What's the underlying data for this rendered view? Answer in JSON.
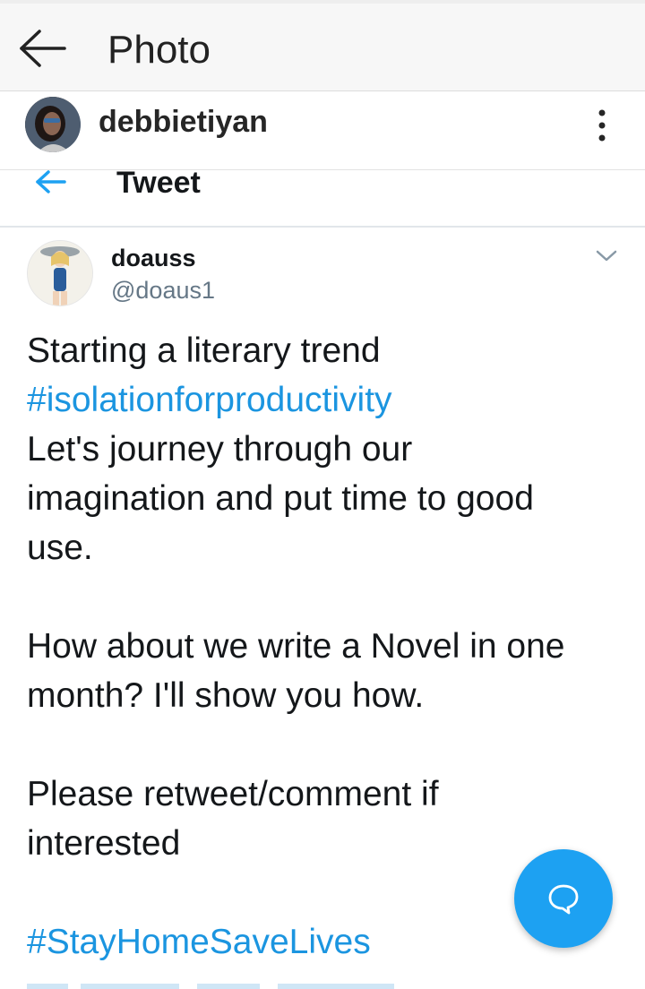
{
  "topbar": {
    "title": "Photo",
    "back_icon": "arrow-left-icon"
  },
  "post": {
    "username": "debbietiyan",
    "more_icon": "more-vertical-icon"
  },
  "tweet_screen": {
    "nav_title": "Tweet",
    "back_icon": "arrow-left-icon",
    "author": {
      "name": "doauss",
      "handle": "@doaus1"
    },
    "menu_icon": "chevron-down-icon",
    "lines": [
      {
        "text": "Starting a literary trend",
        "type": "text"
      },
      {
        "text": "#isolationforproductivity",
        "type": "hashtag"
      },
      {
        "text": "Let's journey through our",
        "type": "text"
      },
      {
        "text": "imagination and put time to good",
        "type": "text"
      },
      {
        "text": "use.",
        "type": "text"
      },
      {
        "text": "",
        "type": "blank"
      },
      {
        "text": "How about we write a Novel in one",
        "type": "text"
      },
      {
        "text": "month? I'll show you how.",
        "type": "text"
      },
      {
        "text": "",
        "type": "blank"
      },
      {
        "text": "Please retweet/comment if",
        "type": "text"
      },
      {
        "text": "interested",
        "type": "text"
      },
      {
        "text": "",
        "type": "blank"
      },
      {
        "text": "#StayHomeSaveLives",
        "type": "hashtag"
      }
    ],
    "fab_icon": "reply-bubble-icon"
  },
  "colors": {
    "accent": "#1da1f2",
    "hashtag": "#1b95e0",
    "handle": "#657786"
  }
}
